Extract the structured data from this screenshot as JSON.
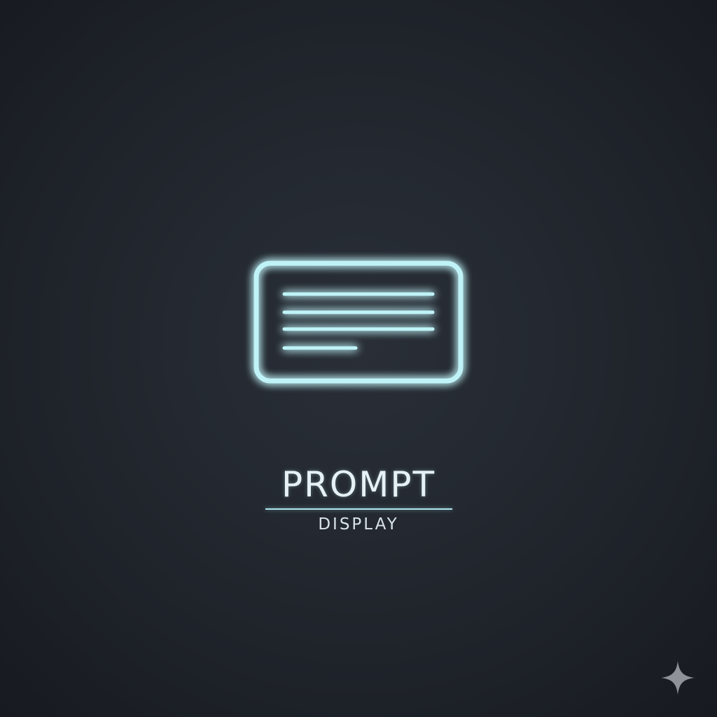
{
  "title": "PROMPT",
  "subtitle": "DISPLAY",
  "icons": {
    "emblem": "text-card-icon",
    "corner": "sparkle-icon"
  },
  "colors": {
    "background": "#22262d",
    "glow": "#aeeef5",
    "text": "#e6f1f6",
    "sparkle": "#8f9399"
  }
}
